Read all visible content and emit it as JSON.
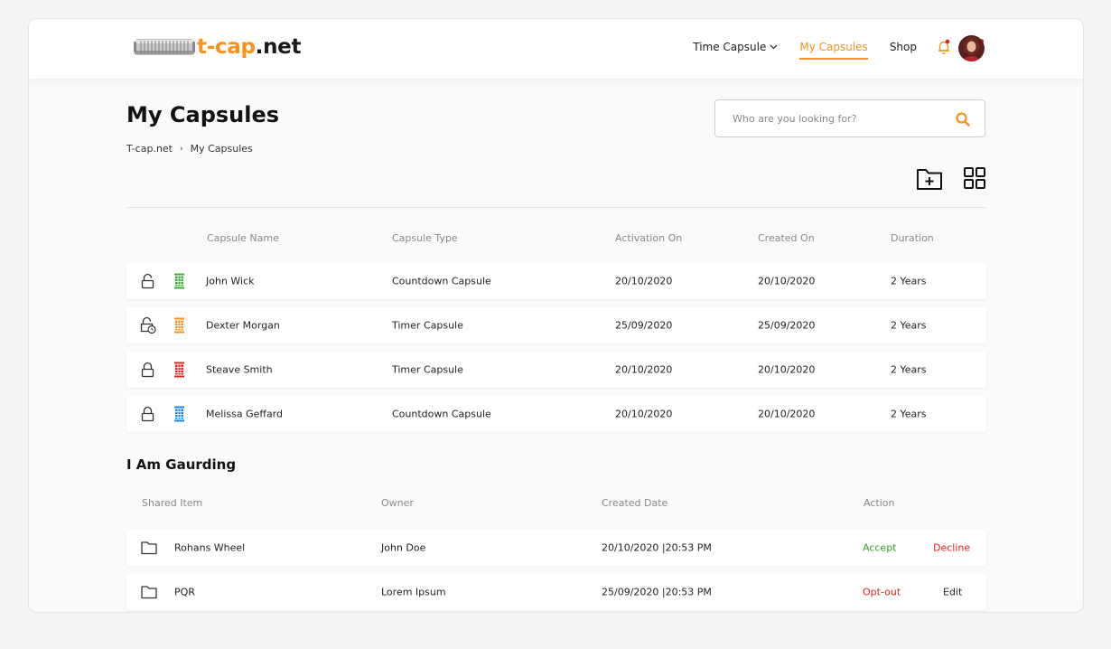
{
  "brand": {
    "name_accent": "t-cap",
    "name_rest": ".net"
  },
  "nav": {
    "items": [
      {
        "label": "Time Capsule",
        "dropdown": true
      },
      {
        "label": "My Capsules",
        "active": true
      },
      {
        "label": "Shop"
      }
    ],
    "accent_color": "#f7931e"
  },
  "page": {
    "title": "My Capsules"
  },
  "breadcrumb": {
    "root": "T-cap.net",
    "separator": "›",
    "current": "My Capsules"
  },
  "search": {
    "placeholder": "Who are you looking for?",
    "value": ""
  },
  "capsules": {
    "columns": [
      "Capsule Name",
      "Capsule Type",
      "Activation On",
      "Created On",
      "Duration"
    ],
    "rows": [
      {
        "lock": "lock-open-icon",
        "can_color": "#3fae3a",
        "name": "John Wick",
        "type": "Countdown Capsule",
        "activation": "20/10/2020",
        "created": "20/10/2020",
        "duration": "2 Years"
      },
      {
        "lock": "lock-timer-icon",
        "can_color": "#f7931e",
        "name": "Dexter Morgan",
        "type": "Timer Capsule",
        "activation": "25/09/2020",
        "created": "25/09/2020",
        "duration": "2 Years"
      },
      {
        "lock": "lock-icon",
        "can_color": "#e02424",
        "name": "Steave Smith",
        "type": "Timer Capsule",
        "activation": "20/10/2020",
        "created": "20/10/2020",
        "duration": "2 Years"
      },
      {
        "lock": "lock-icon",
        "can_color": "#1e88e5",
        "name": "Melissa Geffard",
        "type": "Countdown Capsule",
        "activation": "20/10/2020",
        "created": "20/10/2020",
        "duration": "2 Years"
      }
    ]
  },
  "guarding": {
    "title": "I Am Gaurding",
    "columns": [
      "Shared Item",
      "Owner",
      "Created Date",
      "Action"
    ],
    "rows": [
      {
        "item": "Rohans Wheel",
        "owner": "John Doe",
        "created": "20/10/2020 |20:53 PM",
        "action_primary": "Accept",
        "action_secondary": "Decline"
      },
      {
        "item": "PQR",
        "owner": "Lorem Ipsum",
        "created": "25/09/2020 |20:53 PM",
        "action_primary": "Opt-out",
        "action_secondary": "Edit"
      }
    ]
  }
}
